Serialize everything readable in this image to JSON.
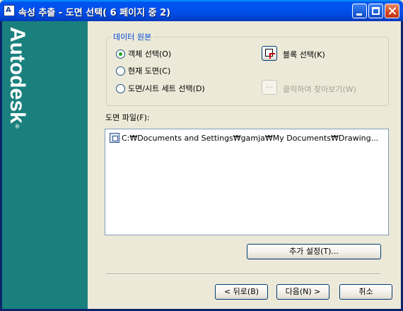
{
  "window": {
    "title": "속성 추출 - 도면 선택( 6 페이지 중 2)"
  },
  "brand": {
    "logo_text": "Autodesk",
    "registered_mark": "®"
  },
  "data_source": {
    "legend": "데이터 원본",
    "options": [
      {
        "label": "객체 선택(O)",
        "selected": true
      },
      {
        "label": "현재 도면(C)",
        "selected": false
      },
      {
        "label": "도면/시트 세트 선택(D)",
        "selected": false
      }
    ],
    "select_objects_label": "블록 선택(K)",
    "browse_button_label": "...",
    "browse_label": "클릭하여 찾아보기(W)"
  },
  "drawing_files": {
    "label": "도면 파일(F):",
    "items": [
      "C:₩Documents and Settings₩gamja₩My Documents₩Drawing..."
    ]
  },
  "buttons": {
    "additional_settings": "추가 설정(T)...",
    "back": "< 뒤로(B)",
    "next": "다음(N) >",
    "cancel": "취소"
  }
}
